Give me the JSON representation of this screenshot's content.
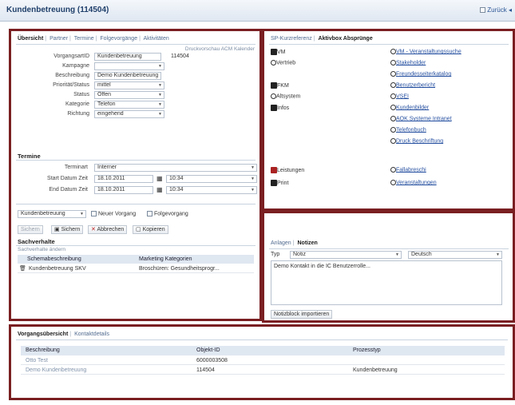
{
  "window": {
    "title": "Kundenbetreuung (114504)",
    "back_label": "Zurück"
  },
  "left_panel": {
    "tabs": [
      "Übersicht",
      "Partner",
      "Termine",
      "Folgevorgänge",
      "Aktivitäten"
    ],
    "toolbar_links": "Druckvorschau  ACM Kalender",
    "fields": [
      {
        "label": "VorgangsartID",
        "value": "Kundenbetreuung",
        "extra": "114504",
        "dropdown": false
      },
      {
        "label": "Kampagne",
        "value": "",
        "dropdown": true
      },
      {
        "label": "Beschreibung",
        "value": "Demo Kundenbetreuung",
        "dropdown": false
      },
      {
        "label": "Priorität/Status",
        "value": "mittel",
        "dropdown": true
      },
      {
        "label": "Status",
        "value": "Offen",
        "dropdown": true
      },
      {
        "label": "Kategorie",
        "value": "Telefon",
        "dropdown": true
      },
      {
        "label": "Richtung",
        "value": "eingehend",
        "dropdown": true
      }
    ],
    "termine_heading": "Termine",
    "termin_fields": [
      {
        "label": "Terminart",
        "value": "Interner",
        "time": ""
      },
      {
        "label": "Start Datum Zeit",
        "value": "18.10.2011",
        "time": "10:34"
      },
      {
        "label": "End Datum Zeit",
        "value": "18.10.2011",
        "time": "10:34"
      }
    ],
    "followup": {
      "select": "Kundenbetreuung",
      "new_case": "Neuer Vorgang",
      "follow_case": "Folgevorgang"
    },
    "actions": {
      "refresh": "Sichern",
      "save": "Sichern",
      "cancel": "Abbrechen",
      "copy": "Kopieren"
    },
    "sachverhalte": {
      "heading": "Sachverhalte",
      "edit_link": "Sachverhalte ändern",
      "columns": [
        "Schemabeschreibung",
        "Marketing Kategorien"
      ],
      "rows": [
        {
          "schema": "Kundenbetreuung SKV",
          "category": "Broschüren: Gesundheitsprogr..."
        }
      ]
    }
  },
  "right_top_panel": {
    "tabs": [
      "SP-Kurzreferenz",
      "Aktivbox Absprünge"
    ],
    "items": [
      {
        "label": "VM",
        "link": "VM - Veranstaltungssuche"
      },
      {
        "label": "Vertrieb",
        "link": "Stakeholder"
      },
      {
        "label": "",
        "link": "Freundesseiterkatalog"
      },
      {
        "label": "FKM",
        "link": "Benutzerbericht"
      },
      {
        "label": "Altsystem",
        "link": "VSEI"
      },
      {
        "label": "Infos",
        "link": "Kundenbilder"
      },
      {
        "label": "",
        "link": "AOK Systeme Intranet"
      },
      {
        "label": "",
        "link": "Telefonbuch"
      },
      {
        "label": "",
        "link": "Druck Beschriftung"
      },
      {
        "label": "Leistungen",
        "link": "Fallabreschi"
      },
      {
        "label": "Print",
        "link": "Veranstaltungen"
      }
    ]
  },
  "right_bottom_panel": {
    "tabs": [
      "Anlagen",
      "Notizen"
    ],
    "type_label": "Typ",
    "type_value": "Notiz",
    "language_value": "Deutsch",
    "note_text": "Demo Kontakt in die IC Benutzerrolle...",
    "import_button": "Notizblock importieren"
  },
  "bottom_panel": {
    "tabs": [
      "Vorgangsübersicht",
      "Kontaktdetails"
    ],
    "columns": [
      "Beschreibung",
      "Objekt-ID",
      "Prozesstyp"
    ],
    "rows": [
      {
        "desc": "Otto Test",
        "id": "6000003508",
        "type": ""
      },
      {
        "desc": "Demo Kundenbetreuung",
        "id": "114504",
        "type": "Kundenbetreuung"
      }
    ]
  },
  "colors": {
    "frame": "#7a1f22",
    "link": "#2650a0",
    "title": "#1f3f6a"
  }
}
